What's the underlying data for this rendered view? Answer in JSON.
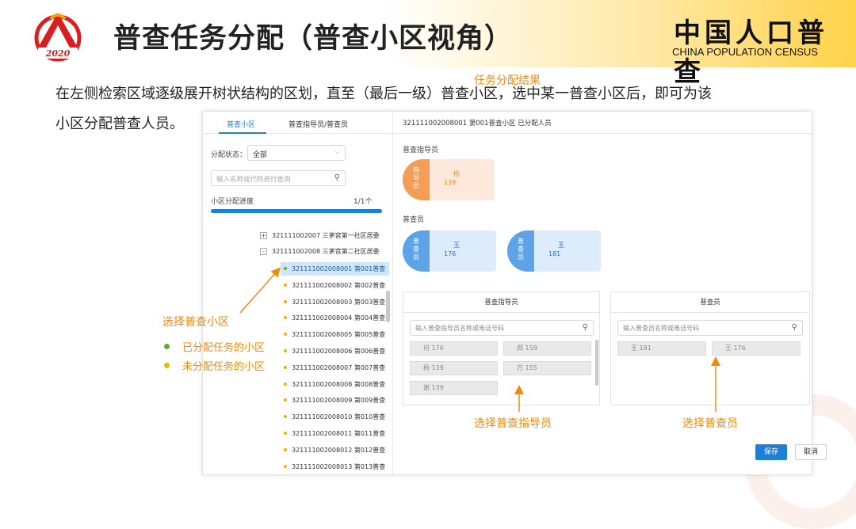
{
  "header": {
    "logo_year": "2020",
    "title": "普查任务分配（普查小区视角）",
    "census_cn": "中国人口普查",
    "census_en": "CHINA POPULATION CENSUS"
  },
  "intro": {
    "line1": "在左侧检索区域逐级展开树状结构的区划，直至（最后一级）普查小区，选中某一普查小区后，即可为该",
    "line2": "小区分配普查人员。"
  },
  "left_panel": {
    "tabs": [
      "普查小区",
      "普查指导员/普查员"
    ],
    "status_label": "分配状态：",
    "status_value": "全部",
    "search_placeholder": "输入名称或代码进行查询",
    "progress_label": "小区分配进度",
    "progress_value": "1/1个",
    "progress_fraction": 1.0,
    "tree_parents": [
      {
        "toggle": "+",
        "label": "321111002007 三茅宫第一社区居委"
      },
      {
        "toggle": "-",
        "label": "321111002008 三茅宫第二社区居委"
      }
    ],
    "tree_leaves": [
      {
        "label": "321111002008001 第001普查",
        "status": "assigned",
        "selected": true
      },
      {
        "label": "321111002008002 第002普查",
        "status": "unassigned",
        "selected": false
      },
      {
        "label": "321111002008003 第003普查",
        "status": "unassigned",
        "selected": false
      },
      {
        "label": "321111002008004 第004普查",
        "status": "unassigned",
        "selected": false
      },
      {
        "label": "321111002008005 第005普查",
        "status": "unassigned",
        "selected": false
      },
      {
        "label": "321111002008006 第006普查",
        "status": "unassigned",
        "selected": false
      },
      {
        "label": "321111002008007 第007普查",
        "status": "unassigned",
        "selected": false
      },
      {
        "label": "321111002008008 第008普查",
        "status": "unassigned",
        "selected": false
      },
      {
        "label": "321111002008009 第009普查",
        "status": "unassigned",
        "selected": false
      },
      {
        "label": "321111002008010 第010普查",
        "status": "unassigned",
        "selected": false
      },
      {
        "label": "321111002008011 第011普查",
        "status": "unassigned",
        "selected": false
      },
      {
        "label": "321111002008012 第012普查",
        "status": "unassigned",
        "selected": false
      },
      {
        "label": "321111002008013 第013普查",
        "status": "unassigned",
        "selected": false
      }
    ]
  },
  "right_panel": {
    "header": "321111002008001 第001普查小区 已分配人员",
    "supervisor_section": "普查指导员",
    "supervisor_card": {
      "role": "指导员",
      "name": "杨",
      "phone": "139"
    },
    "enumerator_section": "普查员",
    "enumerator_cards": [
      {
        "role": "普查员",
        "name": "王",
        "phone": "176"
      },
      {
        "role": "普查员",
        "name": "王",
        "phone": "181"
      }
    ],
    "supervisor_box": {
      "title": "普查指导员",
      "placeholder": "输入普查指导员名称或电话号码",
      "chips": [
        "何 176",
        "郑 159",
        "杨 139",
        "万 155",
        "谢 139"
      ]
    },
    "enumerator_box": {
      "title": "普查员",
      "placeholder": "输入普查员名称或电话号码",
      "chips": [
        "王 181",
        "王 176"
      ]
    },
    "save_label": "保存",
    "cancel_label": "取消"
  },
  "annotations": {
    "result": "任务分配结果",
    "select_area": "选择普查小区",
    "assigned": "已分配任务的小区",
    "unassigned": "未分配任务的小区",
    "select_supervisor": "选择普查指导员",
    "select_enumerator": "选择普查员"
  },
  "colors": {
    "accent_blue": "#1e7fd8",
    "annotation_orange": "#f08a0c",
    "assigned_green": "#6aaa2e",
    "unassigned_yellow": "#f0b400",
    "supervisor_card": "#f59d57",
    "enumerator_card": "#5ea3e6"
  }
}
